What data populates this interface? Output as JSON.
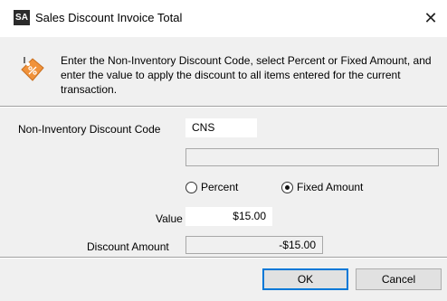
{
  "window": {
    "app_badge": "SA",
    "title": "Sales Discount Invoice Total",
    "close_glyph": "✕"
  },
  "info": {
    "icon": "discount-tag-icon",
    "message": "Enter the Non-Inventory Discount Code, select Percent or Fixed Amount, and enter the value to apply the discount to all items entered for the current transaction."
  },
  "form": {
    "code_label": "Non-Inventory Discount Code",
    "code_value": "CNS",
    "description_value": "",
    "percent_label": "Percent",
    "percent_selected": false,
    "fixed_label": "Fixed Amount",
    "fixed_selected": true,
    "value_label": "Value",
    "value_value": "$15.00",
    "discount_label": "Discount Amount",
    "discount_value": "-$15.00"
  },
  "buttons": {
    "ok_label": "OK",
    "cancel_label": "Cancel"
  },
  "colors": {
    "dialog_bg": "#f0f0f0",
    "tag_orange": "#f0923a",
    "default_button_border": "#0078d7"
  }
}
